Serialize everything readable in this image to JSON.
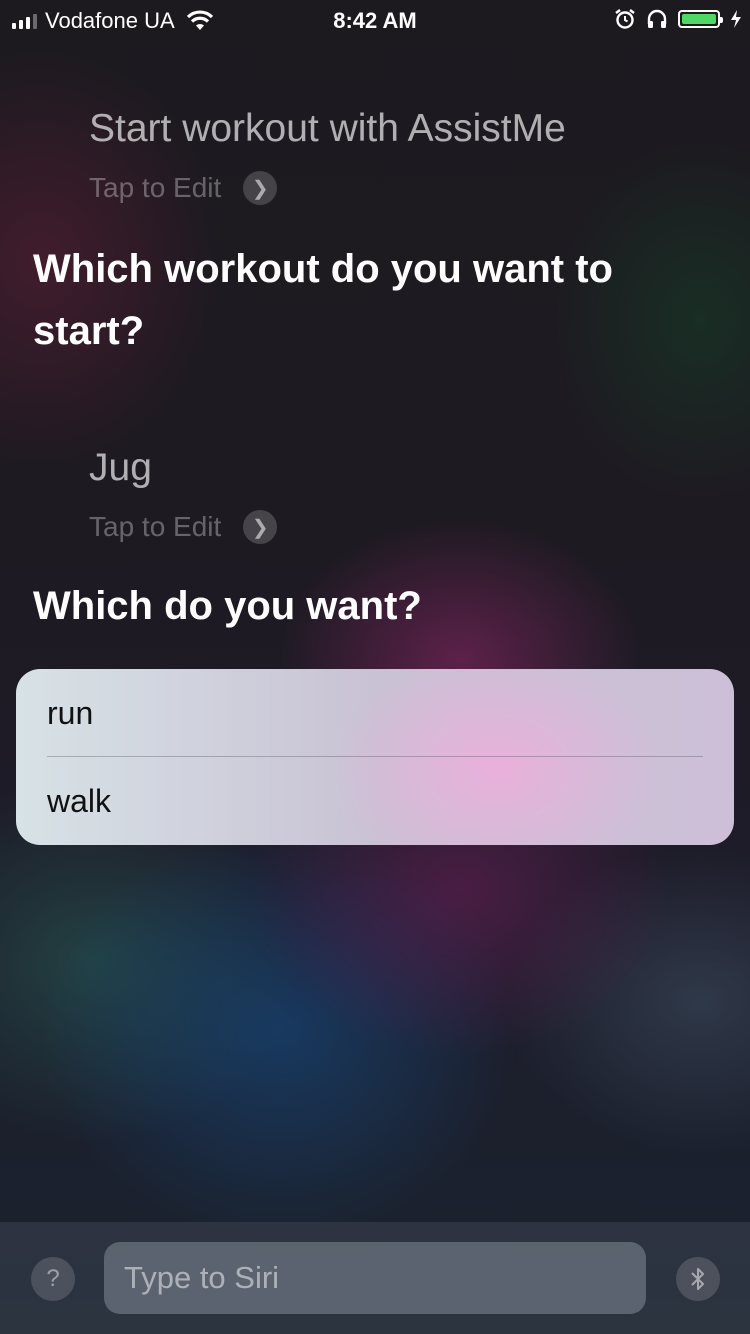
{
  "status_bar": {
    "carrier": "Vodafone UA",
    "time": "8:42 AM",
    "battery_level": 1.0
  },
  "conversation": {
    "utterance_1": "Start workout with AssistMe",
    "tap_to_edit_1": "Tap to Edit",
    "question_1": "Which workout do you want to start?",
    "utterance_2": "Jug",
    "tap_to_edit_2": "Tap to Edit",
    "question_2": "Which do you want?"
  },
  "options": [
    "run",
    "walk"
  ],
  "bottom_bar": {
    "help_label": "?",
    "input_placeholder": "Type to Siri"
  },
  "colors": {
    "battery_fill": "#4cd964"
  },
  "icons": [
    "signal-icon",
    "wifi-icon",
    "alarm-icon",
    "headphones-icon",
    "battery-icon",
    "charging-icon",
    "chevron-right-icon",
    "help-icon",
    "bluetooth-icon"
  ]
}
